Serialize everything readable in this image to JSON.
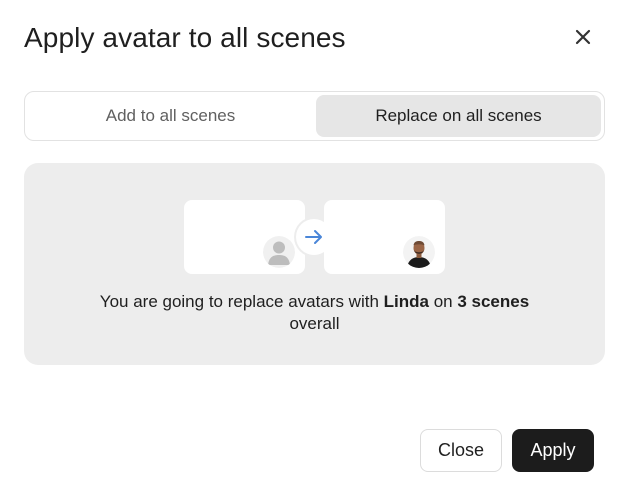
{
  "dialog": {
    "title": "Apply avatar to all scenes",
    "close_icon": "close-icon"
  },
  "tabs": [
    {
      "label": "Add to all scenes",
      "active": false
    },
    {
      "label": "Replace on all scenes",
      "active": true
    }
  ],
  "preview": {
    "from_avatar_icon": "person-placeholder-icon",
    "arrow_icon": "arrow-right-icon",
    "to_avatar_icon": "avatar-photo",
    "message": {
      "prefix": "You are going to replace avatars with ",
      "avatar_name": "Linda",
      "middle": " on ",
      "scene_count": "3 scenes",
      "suffix": " overall"
    }
  },
  "footer": {
    "close_label": "Close",
    "apply_label": "Apply"
  },
  "colors": {
    "accent_arrow": "#4a86d8",
    "panel_bg": "#ededed",
    "apply_bg": "#1c1c1c"
  }
}
